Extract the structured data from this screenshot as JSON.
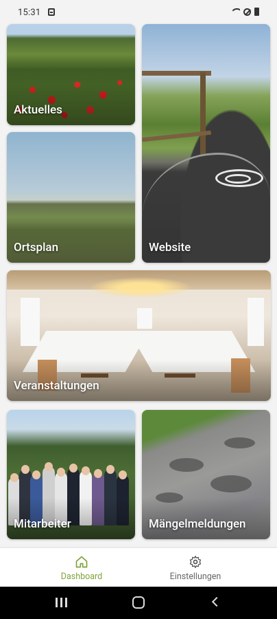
{
  "status_bar": {
    "time": "15:31",
    "icons": [
      "notification-icon",
      "wifi-icon",
      "do-not-disturb-icon",
      "battery-icon"
    ]
  },
  "tiles": [
    {
      "label": "Aktuelles",
      "image": "poppy-field-photo"
    },
    {
      "label": "Ortsplan",
      "image": "landscape-photo"
    },
    {
      "label": "Website",
      "image": "gravel-path-photo"
    },
    {
      "label": "Veranstaltungen",
      "image": "event-hall-photo"
    },
    {
      "label": "Mitarbeiter",
      "image": "staff-group-photo"
    },
    {
      "label": "Mängelmeldungen",
      "image": "damaged-road-photo"
    }
  ],
  "bottom_nav": {
    "items": [
      {
        "label": "Dashboard",
        "icon": "home-icon",
        "active": true
      },
      {
        "label": "Einstellungen",
        "icon": "gear-icon",
        "active": false
      }
    ],
    "accent_color": "#7fa33a"
  },
  "system_nav": {
    "buttons": [
      "recents-button",
      "home-button",
      "back-button"
    ]
  }
}
